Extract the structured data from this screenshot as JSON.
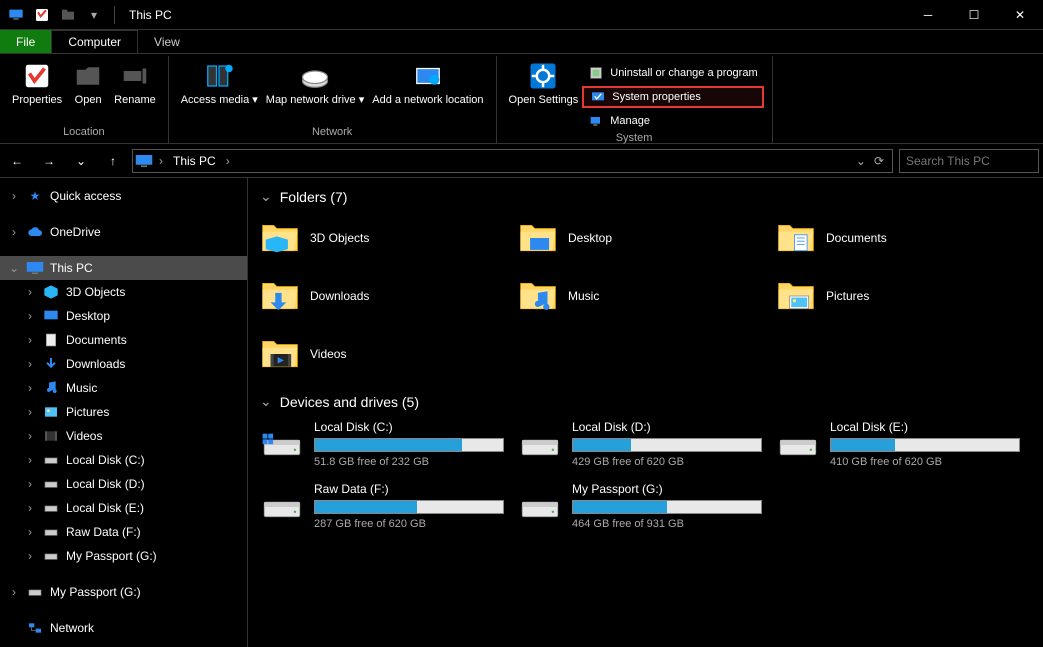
{
  "window": {
    "title": "This PC"
  },
  "ribbon_tabs": {
    "file": "File",
    "computer": "Computer",
    "view": "View"
  },
  "ribbon": {
    "location": {
      "label": "Location",
      "properties": "Properties",
      "open": "Open",
      "rename": "Rename"
    },
    "network": {
      "label": "Network",
      "access_media": "Access media",
      "map_drive": "Map network drive",
      "add_location": "Add a network location"
    },
    "system": {
      "label": "System",
      "open_settings": "Open Settings",
      "uninstall": "Uninstall or change a program",
      "system_properties": "System properties",
      "manage": "Manage"
    }
  },
  "address": {
    "location": "This PC",
    "search_placeholder": "Search This PC"
  },
  "nav": {
    "quick_access": "Quick access",
    "onedrive": "OneDrive",
    "this_pc": "This PC",
    "children": {
      "objects3d": "3D Objects",
      "desktop": "Desktop",
      "documents": "Documents",
      "downloads": "Downloads",
      "music": "Music",
      "pictures": "Pictures",
      "videos": "Videos",
      "local_c": "Local Disk (C:)",
      "local_d": "Local Disk (D:)",
      "local_e": "Local Disk (E:)",
      "raw_f": "Raw Data (F:)",
      "passport_g": "My Passport (G:)"
    },
    "passport_g2": "My Passport (G:)",
    "network": "Network"
  },
  "sections": {
    "folders": "Folders (7)",
    "drives": "Devices and drives (5)"
  },
  "folders": {
    "objects3d": "3D Objects",
    "desktop": "Desktop",
    "documents": "Documents",
    "downloads": "Downloads",
    "music": "Music",
    "pictures": "Pictures",
    "videos": "Videos"
  },
  "drives": [
    {
      "name": "Local Disk (C:)",
      "free": "51.8 GB free of 232 GB",
      "fill_pct": 78,
      "os": true
    },
    {
      "name": "Local Disk (D:)",
      "free": "429 GB free of 620 GB",
      "fill_pct": 31,
      "os": false
    },
    {
      "name": "Local Disk (E:)",
      "free": "410 GB free of 620 GB",
      "fill_pct": 34,
      "os": false
    },
    {
      "name": "Raw Data (F:)",
      "free": "287 GB free of 620 GB",
      "fill_pct": 54,
      "os": false
    },
    {
      "name": "My Passport (G:)",
      "free": "464 GB free of 931 GB",
      "fill_pct": 50,
      "os": false
    }
  ]
}
